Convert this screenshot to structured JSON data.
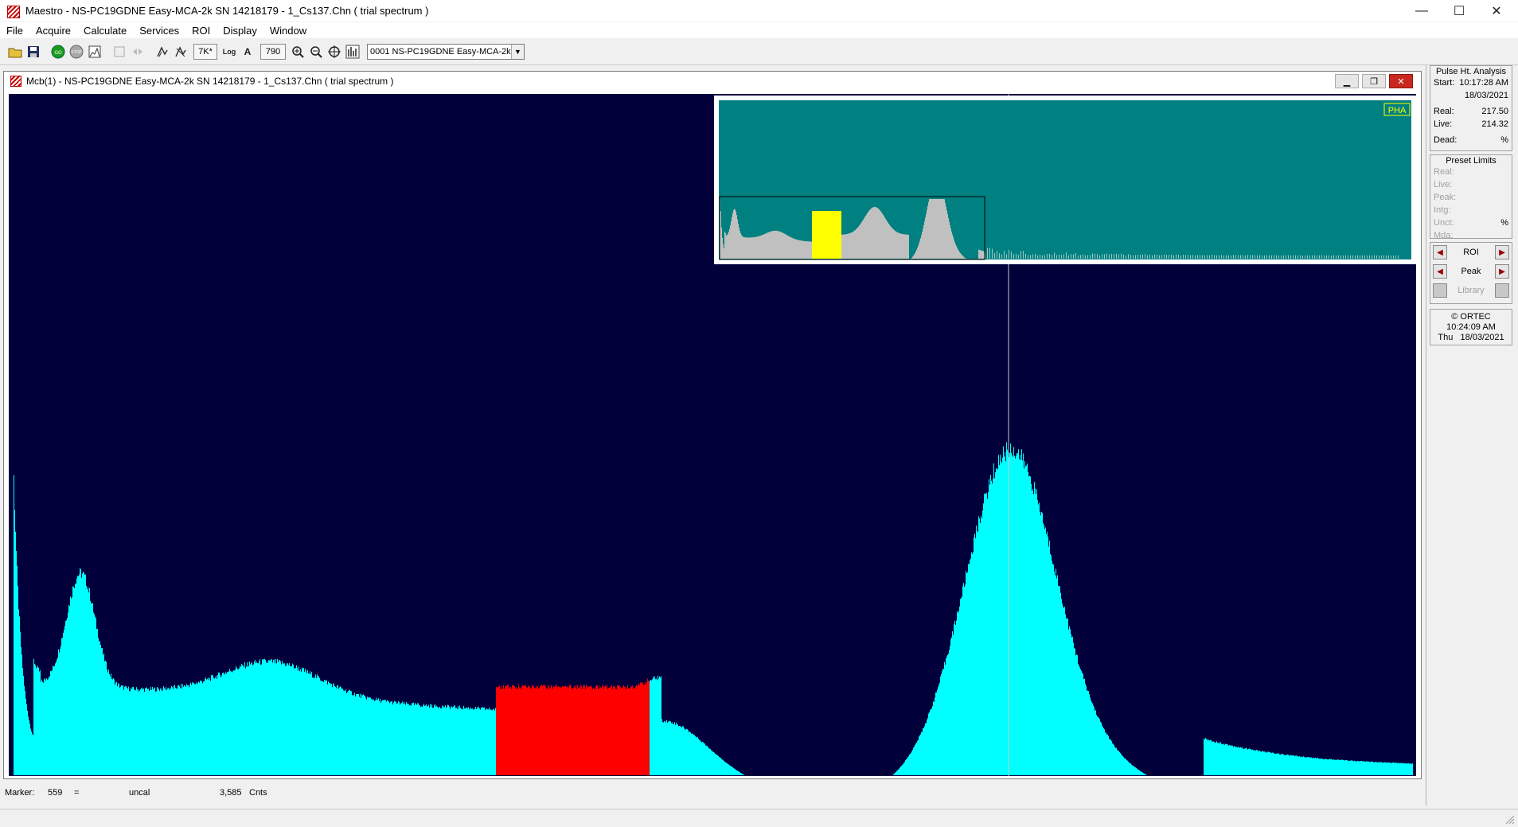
{
  "window": {
    "title": "Maestro - NS-PC19GDNE Easy-MCA-2k SN 14218179 - 1_Cs137.Chn ( trial spectrum )",
    "controls": {
      "minimize": "—",
      "maximize": "☐",
      "close": "✕"
    }
  },
  "menu": [
    "File",
    "Acquire",
    "Calculate",
    "Services",
    "ROI",
    "Display",
    "Window"
  ],
  "toolbar": {
    "vertical_scale": "7K*",
    "log_label": "Log",
    "auto_label": "A",
    "horizontal_scale": "790",
    "detector": "0001  NS-PC19GDNE Easy-MCA-2k"
  },
  "spectrum_window": {
    "title": "Mcb(1) - NS-PC19GDNE Easy-MCA-2k SN 14218179 - 1_Cs137.Chn ( trial spectrum )",
    "overview_badge": "PHA",
    "colors": {
      "background": "#02003b",
      "spectrum": "#00ffff",
      "roi": "#ff0000",
      "overview_bg": "#008080",
      "overview_window": "#c0c0c0",
      "overview_roi": "#ffff00",
      "marker": "#c8c8c8"
    }
  },
  "side_panel": {
    "pha": {
      "title": "Pulse Ht. Analysis",
      "start_label": "Start:",
      "start_time": "10:17:28 AM",
      "start_date": "18/03/2021",
      "real_label": "Real:",
      "real_value": "217.50",
      "live_label": "Live:",
      "live_value": "214.32",
      "dead_label": "Dead:",
      "dead_unit": "%"
    },
    "preset": {
      "title": "Preset Limits",
      "real": "Real:",
      "live": "Live:",
      "peak": "Peak:",
      "intg": "Intg:",
      "unct": "Unct:",
      "unct_unit": "%",
      "mda": "Mda:"
    },
    "nav": {
      "roi": "ROI",
      "peak": "Peak",
      "library": "Library"
    },
    "clock": {
      "copyright": "© ORTEC",
      "time": "10:24:09 AM",
      "day": "Thu",
      "date": "18/03/2021"
    }
  },
  "status": {
    "marker_label": "Marker:",
    "marker_value": "559",
    "equals": "=",
    "energy": "uncal",
    "counts": "3,585",
    "counts_unit": "Cnts"
  }
}
